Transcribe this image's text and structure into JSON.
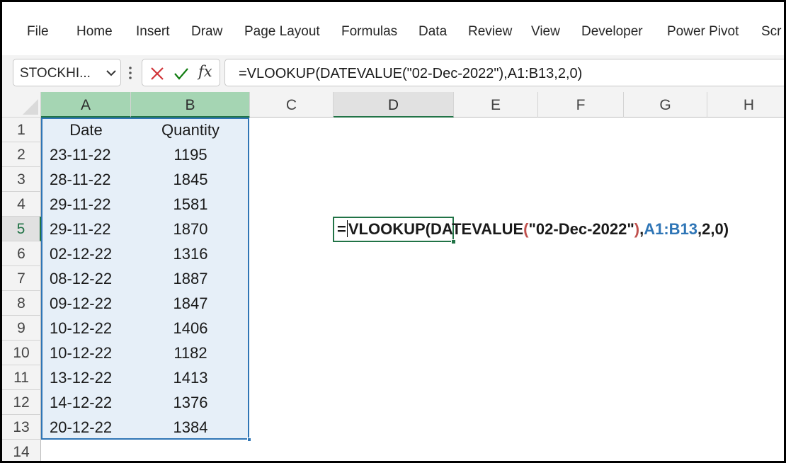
{
  "ribbon": {
    "tabs": [
      "File",
      "Home",
      "Insert",
      "Draw",
      "Page Layout",
      "Formulas",
      "Data",
      "Review",
      "View",
      "Developer",
      "Power Pivot",
      "Scr"
    ]
  },
  "formula_bar": {
    "name_box": "STOCKHI...",
    "cancel_icon": "x-icon",
    "enter_icon": "check-icon",
    "fx_label": "fx",
    "formula": "=VLOOKUP(DATEVALUE(\"02-Dec-2022\"),A1:B13,2,0)"
  },
  "grid": {
    "columns": [
      "A",
      "B",
      "C",
      "D",
      "E",
      "F",
      "G",
      "H"
    ],
    "rows": [
      "1",
      "2",
      "3",
      "4",
      "5",
      "6",
      "7",
      "8",
      "9",
      "10",
      "11",
      "12",
      "13",
      "14"
    ],
    "header": {
      "date": "Date",
      "quantity": "Quantity"
    },
    "data": [
      {
        "date": "23-11-22",
        "qty": "1195"
      },
      {
        "date": "28-11-22",
        "qty": "1845"
      },
      {
        "date": "29-11-22",
        "qty": "1581"
      },
      {
        "date": "29-11-22",
        "qty": "1870"
      },
      {
        "date": "02-12-22",
        "qty": "1316"
      },
      {
        "date": "08-12-22",
        "qty": "1887"
      },
      {
        "date": "09-12-22",
        "qty": "1847"
      },
      {
        "date": "10-12-22",
        "qty": "1406"
      },
      {
        "date": "10-12-22",
        "qty": "1182"
      },
      {
        "date": "13-12-22",
        "qty": "1413"
      },
      {
        "date": "14-12-22",
        "qty": "1376"
      },
      {
        "date": "20-12-22",
        "qty": "1384"
      }
    ],
    "active_cell": "D5",
    "edit": {
      "eq": "=",
      "fn1": "VLOOKUP(DATEVALUE",
      "open_paren": "(",
      "str": "\"02-Dec-2022\"",
      "close_paren": ")",
      "comma1": ",",
      "range": "A1:B13",
      "tail": ",2,0)"
    }
  },
  "colors": {
    "accent": "#217346",
    "selection": "#2f75b5",
    "selection_fill": "#e6eff8",
    "paren": "#c0504d",
    "reference": "#2e75b6"
  }
}
